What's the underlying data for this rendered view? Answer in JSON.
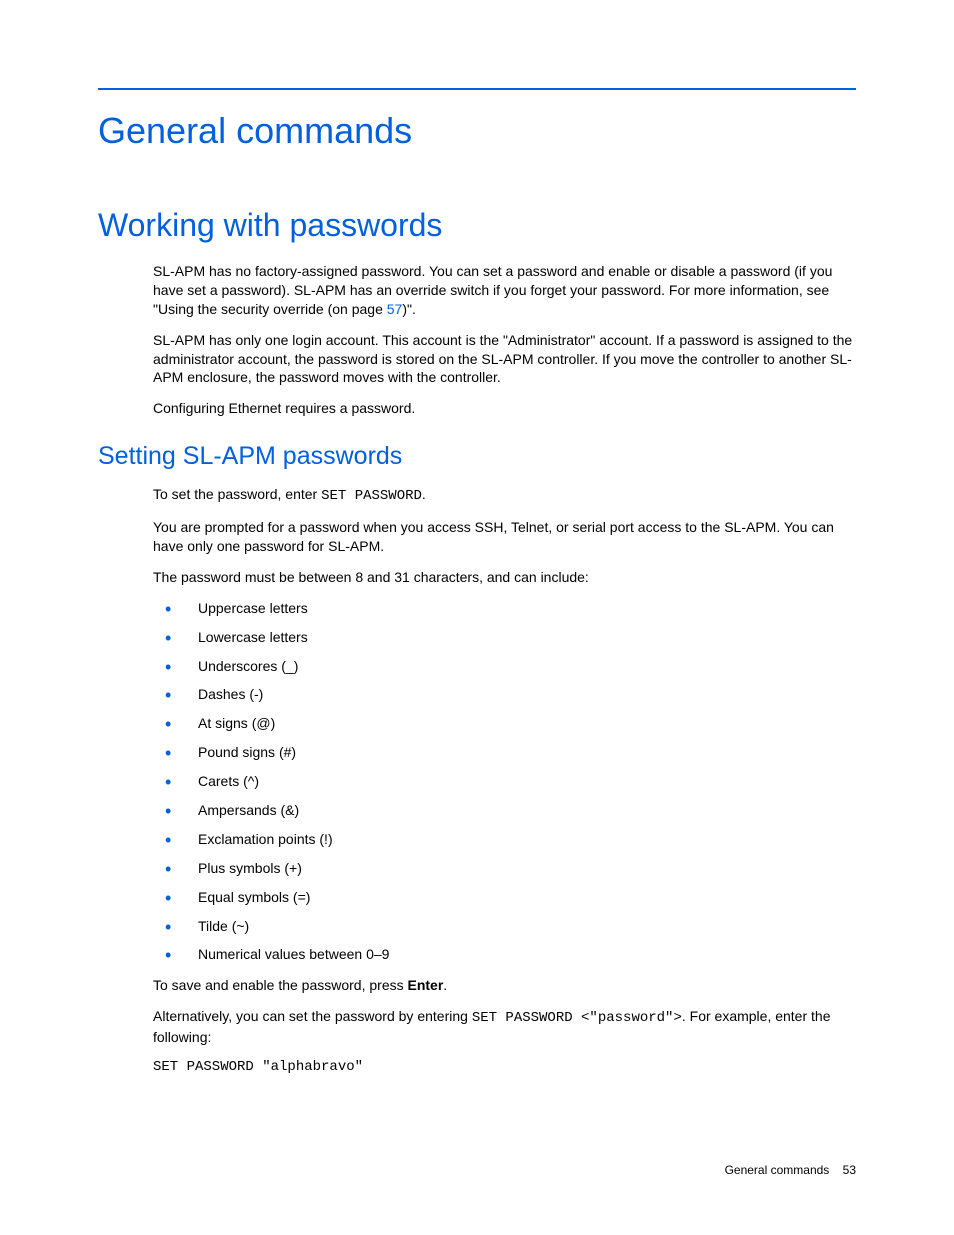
{
  "h1": "General commands",
  "h2": "Working with passwords",
  "para1_pre": "SL-APM has no factory-assigned password. You can set a password and enable or disable a password (if you have set a password). SL-APM has an override switch if you forget your password. For more information, see \"Using the security override (on page ",
  "para1_link": "57",
  "para1_post": ")\".",
  "para2": "SL-APM has only one login account. This account is the \"Administrator\" account. If a password is assigned to the administrator account, the password is stored on the SL-APM controller. If you move the controller to another SL-APM enclosure, the password moves with the controller.",
  "para3": "Configuring Ethernet requires a password.",
  "h3": "Setting SL-APM passwords",
  "para4_pre": "To set the password, enter ",
  "para4_code": "SET PASSWORD",
  "para4_post": ".",
  "para5": "You are prompted for a password when you access SSH, Telnet, or serial port access to the SL-APM. You can have only one password for SL-APM.",
  "para6": "The password must be between 8 and 31 characters, and can include:",
  "bullets": [
    "Uppercase letters",
    "Lowercase letters",
    "Underscores (_)",
    "Dashes (-)",
    "At signs (@)",
    "Pound signs (#)",
    "Carets (^)",
    "Ampersands (&)",
    "Exclamation points (!)",
    "Plus symbols (+)",
    "Equal symbols (=)",
    "Tilde (~)",
    "Numerical values between 0–9"
  ],
  "para7_pre": "To save and enable the password, press ",
  "para7_bold": "Enter",
  "para7_post": ".",
  "para8_pre": "Alternatively, you can set the password by entering ",
  "para8_code": "SET PASSWORD <\"password\">",
  "para8_post": ". For example, enter the following:",
  "codeblock": "SET PASSWORD \"alphabravo\"",
  "footer_label": "General commands",
  "footer_page": "53"
}
